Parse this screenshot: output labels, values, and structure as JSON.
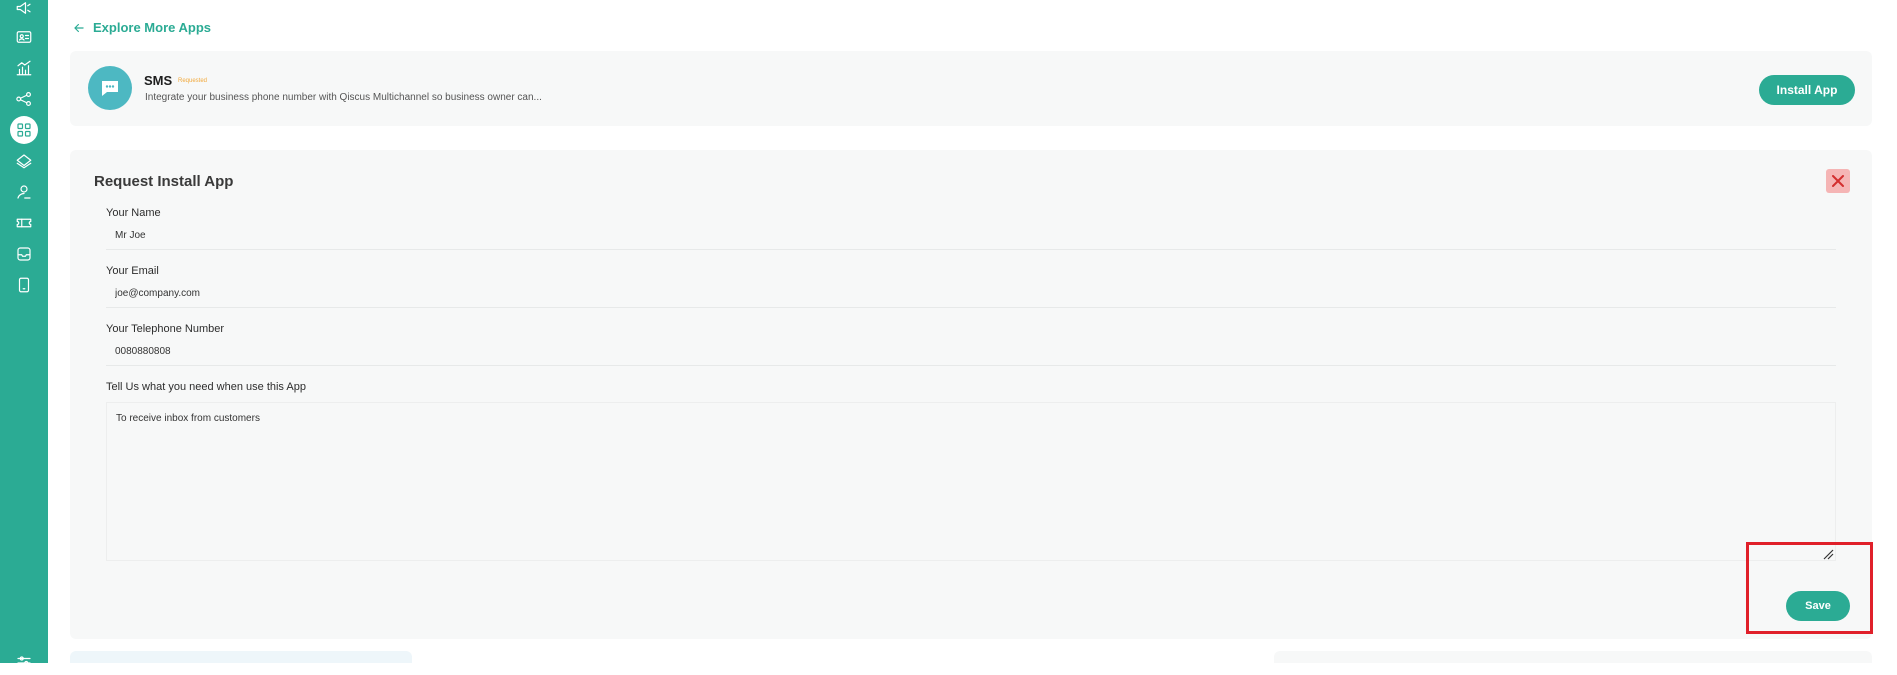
{
  "sidebar": {
    "icons": [
      {
        "name": "megaphone-icon"
      },
      {
        "name": "contact-card-icon"
      },
      {
        "name": "analytics-chart-icon"
      },
      {
        "name": "share-nodes-icon"
      },
      {
        "name": "apps-grid-icon",
        "active": true
      },
      {
        "name": "layers-stack-icon"
      },
      {
        "name": "agent-user-icon"
      },
      {
        "name": "ticket-icon"
      },
      {
        "name": "inbox-icon"
      },
      {
        "name": "mobile-device-icon"
      },
      {
        "name": "settings-sliders-icon"
      }
    ]
  },
  "nav": {
    "back_label": "Explore More Apps"
  },
  "app": {
    "name": "SMS",
    "badge": "Requested",
    "description": "Integrate your business phone number with Qiscus Multichannel so business owner can...",
    "install_label": "Install App",
    "icon": "chat-bubble-icon"
  },
  "form": {
    "title": "Request Install App",
    "fields": {
      "name": {
        "label": "Your Name",
        "value": "Mr Joe"
      },
      "email": {
        "label": "Your Email",
        "value": "joe@company.com"
      },
      "phone": {
        "label": "Your Telephone Number",
        "value": "0080880808"
      },
      "needs": {
        "label": "Tell Us what you need when use this App",
        "value": "To receive inbox from customers"
      }
    },
    "save_label": "Save"
  },
  "colors": {
    "accent": "#2bab94",
    "highlight": "#e0202a",
    "badge": "#f2a93b",
    "app_icon_bg": "#4db8c2"
  }
}
